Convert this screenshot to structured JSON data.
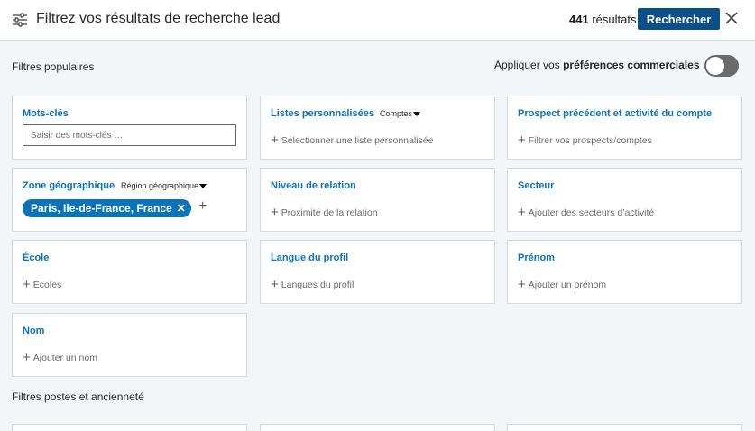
{
  "header": {
    "title": "Filtrez vos résultats de recherche lead",
    "results_count": "441",
    "results_label": "résultats",
    "search_button": "Rechercher"
  },
  "popular": {
    "section_title": "Filtres populaires",
    "pref_prefix": "Appliquer vos",
    "pref_bold": "préférences commerciales",
    "toggle_on": false
  },
  "cards": {
    "keywords": {
      "label": "Mots-clés",
      "placeholder": "Saisir des mots-clés …"
    },
    "custom_lists": {
      "label": "Listes personnalisées",
      "dropdown": "Comptes",
      "action": "Sélectionner une liste personnalisée"
    },
    "prospect_activity": {
      "label": "Prospect précédent et activité du compte",
      "action": "Filtrer vos prospects/comptes"
    },
    "geography": {
      "label": "Zone géographique",
      "dropdown": "Région géographique",
      "selected": "Paris, Ile-de-France, France"
    },
    "relation": {
      "label": "Niveau de relation",
      "action": "Proximité de la relation"
    },
    "sector": {
      "label": "Secteur",
      "action": "Ajouter des secteurs d’activité"
    },
    "school": {
      "label": "École",
      "action": "Écoles"
    },
    "language": {
      "label": "Langue du profil",
      "action": "Langues du profil"
    },
    "firstname": {
      "label": "Prénom",
      "action": "Ajouter un prénom"
    },
    "lastname": {
      "label": "Nom",
      "action": "Ajouter un nom"
    }
  },
  "positions": {
    "section_title": "Filtres postes et ancienneté"
  },
  "colors": {
    "accent": "#0b73b7",
    "button": "#0b4f8a",
    "background": "#f3f6f8"
  }
}
